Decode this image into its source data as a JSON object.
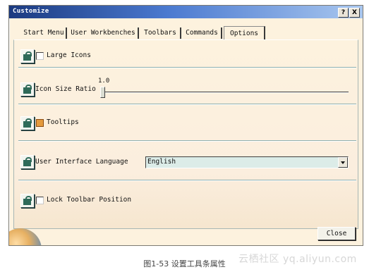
{
  "window": {
    "title": "Customize",
    "help_button": "?",
    "close_button": "X"
  },
  "tabs": [
    {
      "label": "Start Menu",
      "active": false
    },
    {
      "label": "User Workbenches",
      "active": false
    },
    {
      "label": "Toolbars",
      "active": false
    },
    {
      "label": "Commands",
      "active": false
    },
    {
      "label": "Options",
      "active": true
    }
  ],
  "options": {
    "large_icons": {
      "label": "Large Icons",
      "checked": false
    },
    "icon_size_ratio": {
      "label": "Icon Size Ratio",
      "value": "1.0"
    },
    "tooltips": {
      "label": "Tooltips",
      "checked": true
    },
    "ui_language": {
      "label": "User Interface Language",
      "selected": "English"
    },
    "lock_toolbar": {
      "label": "Lock Toolbar Position",
      "checked": false
    }
  },
  "footer": {
    "close_label": "Close"
  },
  "caption": "图1-53 设置工具条属性",
  "watermark": "云栖社区 yq.aliyun.com",
  "colors": {
    "panel_bg": "#fdf2de",
    "title_bar_start": "#1b3a80",
    "title_bar_end": "#a9c7ef",
    "select_bg": "#dcece8",
    "checkbox_on": "#e49a3d"
  }
}
